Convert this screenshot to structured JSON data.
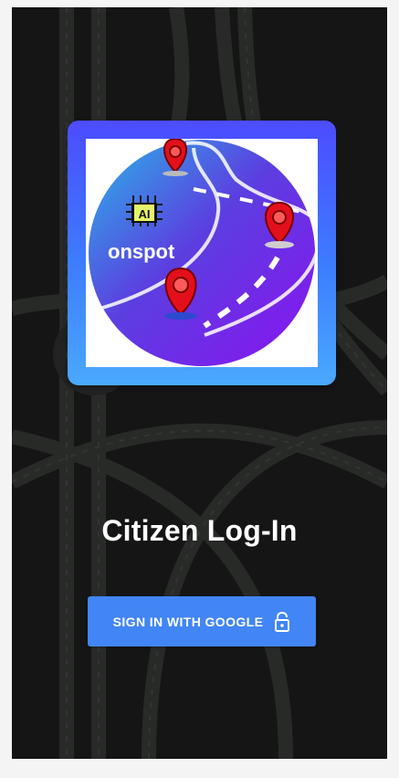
{
  "app": {
    "logo_text": "onspot",
    "logo_badge": "AI",
    "title": "Citizen Log-In"
  },
  "signin_button": {
    "label": "SIGN IN WITH GOOGLE",
    "icon": "lock-open-icon"
  },
  "colors": {
    "button_blue": "#4285f4",
    "card_gradient_top": "#4c4cff",
    "card_gradient_bottom": "#4aa9ff",
    "pin_red": "#e3101b"
  }
}
